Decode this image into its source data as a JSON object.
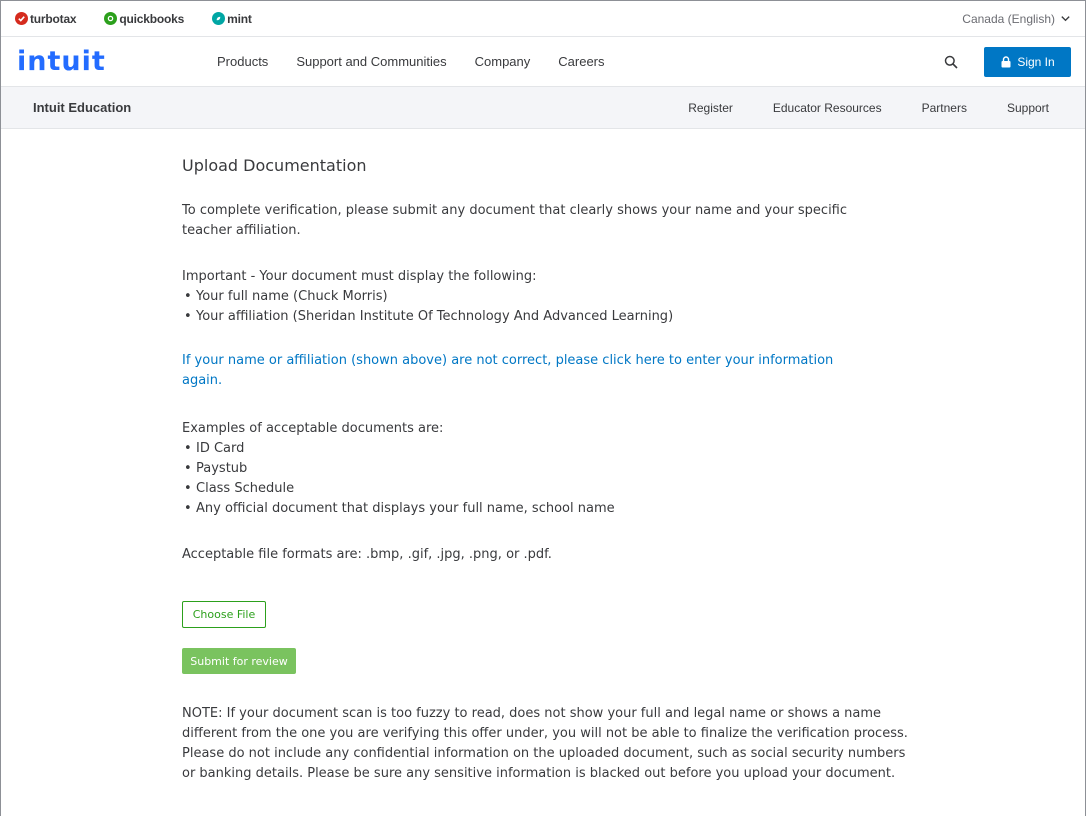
{
  "brand_bar": {
    "brands": [
      {
        "name": "turbotax",
        "icon": "turbotax-check-icon",
        "color": "#d52b1e"
      },
      {
        "name": "quickbooks",
        "icon": "quickbooks-qb-icon",
        "color": "#2ca01c"
      },
      {
        "name": "mint",
        "icon": "mint-leaf-icon",
        "color": "#00a6a4"
      }
    ],
    "region": "Canada (English)"
  },
  "main_nav": {
    "logo": "intuit",
    "links": [
      "Products",
      "Support and Communities",
      "Company",
      "Careers"
    ],
    "signin_label": "Sign In"
  },
  "sub_nav": {
    "title": "Intuit Education",
    "links": [
      "Register",
      "Educator Resources",
      "Partners",
      "Support"
    ]
  },
  "content": {
    "heading": "Upload Documentation",
    "intro": "To complete verification, please submit any document that clearly shows your name and your specific teacher affiliation.",
    "important_label": "Important - Your document must display the following:",
    "required_items": [
      "Your full name (Chuck Morris)",
      "Your affiliation (Sheridan Institute Of Technology And Advanced Learning)"
    ],
    "correction_link": "If your name or affiliation (shown above) are not correct, please click here to enter your information again.",
    "examples_label": "Examples of acceptable documents are:",
    "examples": [
      "ID Card",
      "Paystub",
      "Class Schedule",
      "Any official document that displays your full name, school name"
    ],
    "formats": "Acceptable file formats are: .bmp, .gif, .jpg, .png, or .pdf.",
    "choose_file_label": "Choose File",
    "submit_label": "Submit for review",
    "note": "NOTE: If your document scan is too fuzzy to read, does not show your full and legal name or shows a name different from the one you are verifying this offer under, you will not be able to finalize the verification process. Please do not include any confidential information on the uploaded document, such as social security numbers or banking details. Please be sure any sensitive information is blacked out before you upload your document."
  },
  "colors": {
    "link_blue": "#0077c5",
    "signin_blue": "#0077c5",
    "submit_green": "#7ac35f",
    "choose_green": "#2ca01c",
    "logo_blue": "#236cff"
  }
}
